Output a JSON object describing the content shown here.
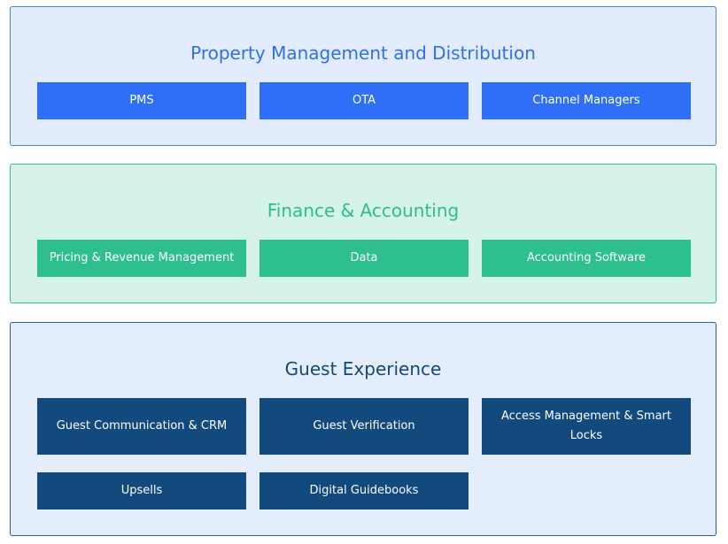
{
  "sections": [
    {
      "title": "Property Management and Distribution",
      "items": [
        "PMS",
        "OTA",
        "Channel Managers"
      ],
      "color": "#2f6ff8"
    },
    {
      "title": "Finance & Accounting",
      "items": [
        "Pricing & Revenue Management",
        "Data",
        "Accounting Software"
      ],
      "color": "#2dbf90"
    },
    {
      "title": "Guest Experience",
      "items": [
        "Guest Communication & CRM",
        "Guest Verification",
        "Access Management & Smart Locks",
        "Upsells",
        "Digital Guidebooks"
      ],
      "color": "#134a7e"
    }
  ]
}
